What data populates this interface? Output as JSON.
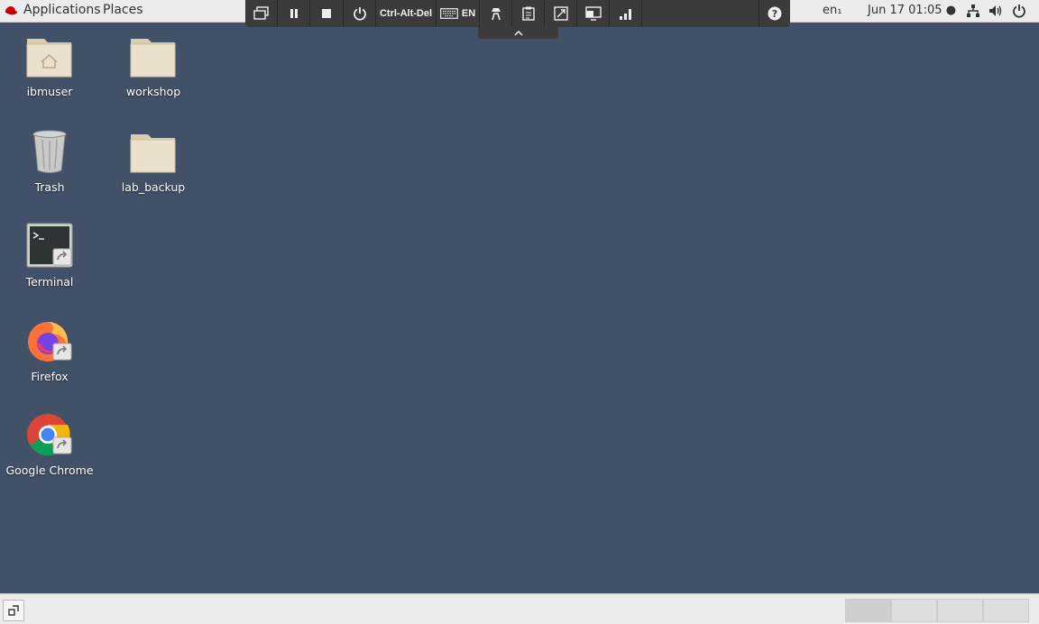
{
  "top_panel": {
    "applications_label": "Applications",
    "places_label": "Places",
    "language": "en₁",
    "clock": "Jun 17  01:05 ●"
  },
  "vm_toolbar": {
    "ctrl_alt_del_label": "Ctrl-Alt-Del",
    "keyboard_lang_label": "EN"
  },
  "desktop": {
    "icons": [
      {
        "label": "ibmuser"
      },
      {
        "label": "workshop"
      },
      {
        "label": "Trash"
      },
      {
        "label": "lab_backup"
      },
      {
        "label": "Terminal"
      },
      {
        "label": "Firefox"
      },
      {
        "label": "Google Chrome"
      }
    ],
    "background_color": "#435168"
  },
  "bottom_panel": {
    "workspaces": 4,
    "active_workspace": 1
  }
}
